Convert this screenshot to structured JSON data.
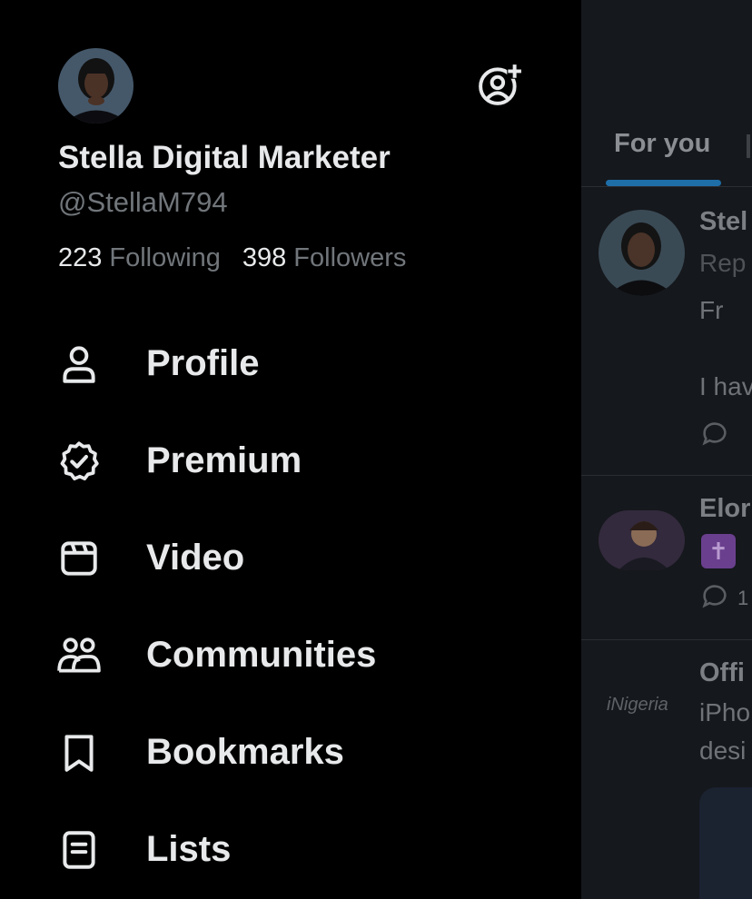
{
  "drawer": {
    "account": {
      "display_name": "Stella Digital Marketer",
      "handle": "@StellaM794",
      "following_count": "223",
      "following_label": "Following",
      "followers_count": "398",
      "followers_label": "Followers"
    },
    "menu": [
      {
        "label": "Profile",
        "icon": "person-icon"
      },
      {
        "label": "Premium",
        "icon": "verified-badge-icon"
      },
      {
        "label": "Video",
        "icon": "clapperboard-icon"
      },
      {
        "label": "Communities",
        "icon": "people-icon"
      },
      {
        "label": "Bookmarks",
        "icon": "bookmark-icon"
      },
      {
        "label": "Lists",
        "icon": "list-icon"
      }
    ]
  },
  "timeline": {
    "tab_for_you": "For you",
    "posts": [
      {
        "name": "Stel",
        "line1": "Rep",
        "line2": "Fr",
        "line3": "I hav"
      },
      {
        "name": "Elor",
        "reply_count": "1"
      },
      {
        "name": "Offi",
        "brand": "iNigeria",
        "line1": "iPho",
        "line2": "desi"
      }
    ]
  },
  "colors": {
    "background": "#000000",
    "primary_text": "#e7e9ea",
    "secondary_text": "#71767b",
    "accent": "#1d9bf0"
  }
}
